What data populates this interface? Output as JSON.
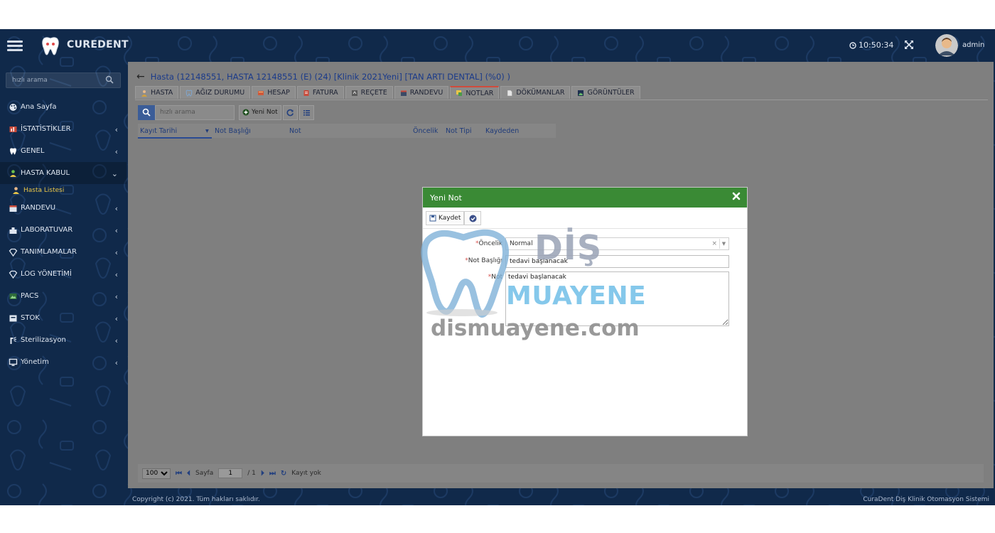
{
  "header": {
    "brand": "CUREDENT",
    "clock": "10:50:34",
    "username": "admin"
  },
  "sidebar": {
    "search_placeholder": "hızlı arama",
    "items": [
      {
        "label": "Ana Sayfa",
        "icon": "palette-icon"
      },
      {
        "label": "İSTATİSTİKLER",
        "icon": "chart-icon"
      },
      {
        "label": "GENEL",
        "icon": "tooth-icon"
      },
      {
        "label": "HASTA KABUL",
        "icon": "user-icon"
      },
      {
        "label": "Hasta Listesi",
        "icon": "patient-icon"
      },
      {
        "label": "RANDEVU",
        "icon": "calendar-icon"
      },
      {
        "label": "LABORATUVAR",
        "icon": "lab-icon"
      },
      {
        "label": "TANIMLAMALAR",
        "icon": "diamond-icon"
      },
      {
        "label": "LOG YÖNETİMİ",
        "icon": "diamond-icon"
      },
      {
        "label": "PACS",
        "icon": "image-icon"
      },
      {
        "label": "STOK",
        "icon": "box-icon"
      },
      {
        "label": "Sterilizasyon",
        "icon": "spray-icon"
      },
      {
        "label": "Yönetim",
        "icon": "monitor-icon"
      }
    ]
  },
  "page": {
    "title": "Hasta (12148551, HASTA 12148551 (E) (24) [Klinik 2021Yeni] [TAN ARTI DENTAL] (%0) )"
  },
  "tabs": [
    {
      "label": "HASTA"
    },
    {
      "label": "AĞIZ DURUMU"
    },
    {
      "label": "HESAP"
    },
    {
      "label": "FATURA"
    },
    {
      "label": "REÇETE"
    },
    {
      "label": "RANDEVU"
    },
    {
      "label": "NOTLAR"
    },
    {
      "label": "DÖKÜMANLAR"
    },
    {
      "label": "GÖRÜNTÜLER"
    }
  ],
  "toolbar": {
    "search_placeholder": "hızlı arama",
    "new_note_label": "Yeni Not"
  },
  "grid": {
    "columns": [
      "Kayıt Tarihi",
      "Not Başlığı",
      "Not",
      "Öncelik",
      "Not Tipi",
      "Kaydeden"
    ]
  },
  "pager": {
    "page_size": "100",
    "page_label": "Sayfa",
    "page_value": "1",
    "page_total": "/ 1",
    "no_records": "Kayıt yok"
  },
  "footer": {
    "copyright": "Copyright (c) 2021. Tüm hakları saklıdır.",
    "product": "CuraDent Diş Klinik Otomasyon Sistemi"
  },
  "modal": {
    "title": "Yeni Not",
    "save_label": "Kaydet",
    "priority_label": "Öncelik",
    "priority_value": "Normal",
    "note_title_label": "Not Başlığı",
    "note_title_value": "tedavi başlanacak",
    "note_label": "Not",
    "note_value": "tedavi başlanacak"
  },
  "watermark": {
    "line1": "DİŞ",
    "line2": "MUAYENE",
    "url": "dismuayene.com"
  },
  "colors": {
    "app_bg": "#10294a",
    "panel_overlay": "#7f7f7f",
    "modal_header": "#3a8a35",
    "title_blue": "#1a3a8a",
    "active_tab_accent": "#d04b3c"
  }
}
